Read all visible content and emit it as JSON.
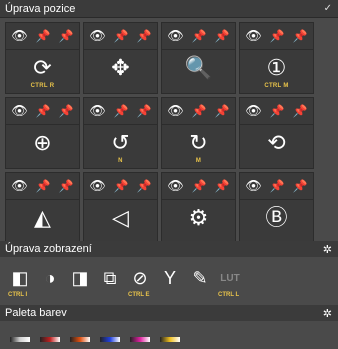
{
  "sections": {
    "position": {
      "title": "Úprava pozice",
      "collapse_icon": "check-icon"
    },
    "display": {
      "title": "Úprava zobrazení",
      "settings_icon": "gear-icon"
    },
    "palette": {
      "title": "Paleta barev",
      "settings_icon": "gear-icon"
    }
  },
  "tools": [
    {
      "name": "refresh",
      "glyph": "⟳",
      "shortcut": "CTRL R"
    },
    {
      "name": "move",
      "glyph": "✥",
      "shortcut": ""
    },
    {
      "name": "zoom",
      "glyph": "🔍",
      "shortcut": ""
    },
    {
      "name": "zoom-one",
      "glyph": "①",
      "shortcut": "CTRL M"
    },
    {
      "name": "magnifier",
      "glyph": "⊕",
      "shortcut": ""
    },
    {
      "name": "rotate",
      "glyph": "↺",
      "shortcut": "N"
    },
    {
      "name": "rotate-alt",
      "glyph": "↻",
      "shortcut": "M"
    },
    {
      "name": "recenter",
      "glyph": "⟲",
      "shortcut": ""
    },
    {
      "name": "flip-horizontal",
      "glyph": "◭",
      "shortcut": ""
    },
    {
      "name": "flip-vertical",
      "glyph": "◁",
      "shortcut": ""
    },
    {
      "name": "measure",
      "glyph": "⚙",
      "shortcut": ""
    },
    {
      "name": "calibrate",
      "glyph": "Ⓑ",
      "shortcut": ""
    }
  ],
  "display_tools": [
    {
      "name": "invert",
      "glyph": "◧",
      "shortcut": "CTRL I"
    },
    {
      "name": "contrast",
      "glyph": "◑",
      "shortcut": ""
    },
    {
      "name": "window-level",
      "glyph": "◨",
      "shortcut": ""
    },
    {
      "name": "crop",
      "glyph": "⧉",
      "shortcut": ""
    },
    {
      "name": "edge",
      "glyph": "⊘",
      "shortcut": "CTRL E"
    },
    {
      "name": "gamma",
      "glyph": "Y",
      "shortcut": ""
    },
    {
      "name": "magic-wand",
      "glyph": "✎",
      "shortcut": ""
    },
    {
      "name": "lut",
      "glyph": "LUT",
      "shortcut": "CTRL L"
    }
  ],
  "palette_colors": [
    "#d0d0d0",
    "#c02020",
    "#e05010",
    "#2040e0",
    "#e020a0",
    "#f0c020"
  ]
}
